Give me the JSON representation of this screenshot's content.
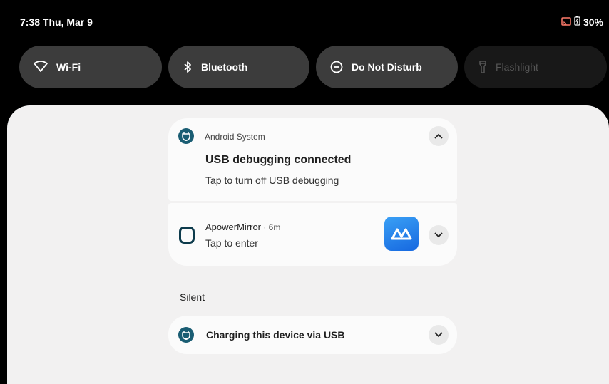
{
  "status_bar": {
    "time_date": "7:38 Thu, Mar 9",
    "battery_percent": "30%",
    "icons": [
      "cast-icon",
      "battery-charging-icon"
    ]
  },
  "quick_tiles": [
    {
      "label": "Wi-Fi",
      "icon": "wifi-icon",
      "state": "active"
    },
    {
      "label": "Bluetooth",
      "icon": "bluetooth-icon",
      "state": "active"
    },
    {
      "label": "Do Not Disturb",
      "icon": "dnd-icon",
      "state": "active"
    },
    {
      "label": "Flashlight",
      "icon": "flashlight-icon",
      "state": "unavailable"
    }
  ],
  "notifications": [
    {
      "app_name": "Android System",
      "title": "USB debugging connected",
      "body": "Tap to turn off USB debugging",
      "expanded": true,
      "icon": "android-system-icon"
    },
    {
      "app_name": "ApowerMirror",
      "meta": " · 6m",
      "body": "Tap to enter",
      "expanded": false,
      "icon": "apowermirror-icon"
    }
  ],
  "silent_section": {
    "header": "Silent",
    "notifications": [
      {
        "title": "Charging this device via USB",
        "expanded": false,
        "icon": "android-system-icon"
      }
    ]
  },
  "colors": {
    "shade_bg": "#f2f1f1",
    "card_bg": "#fbfbfb",
    "tile_active": "#3c3c3c",
    "app_icon": "#1a5d73",
    "apower_blue": "#2f86ee"
  }
}
